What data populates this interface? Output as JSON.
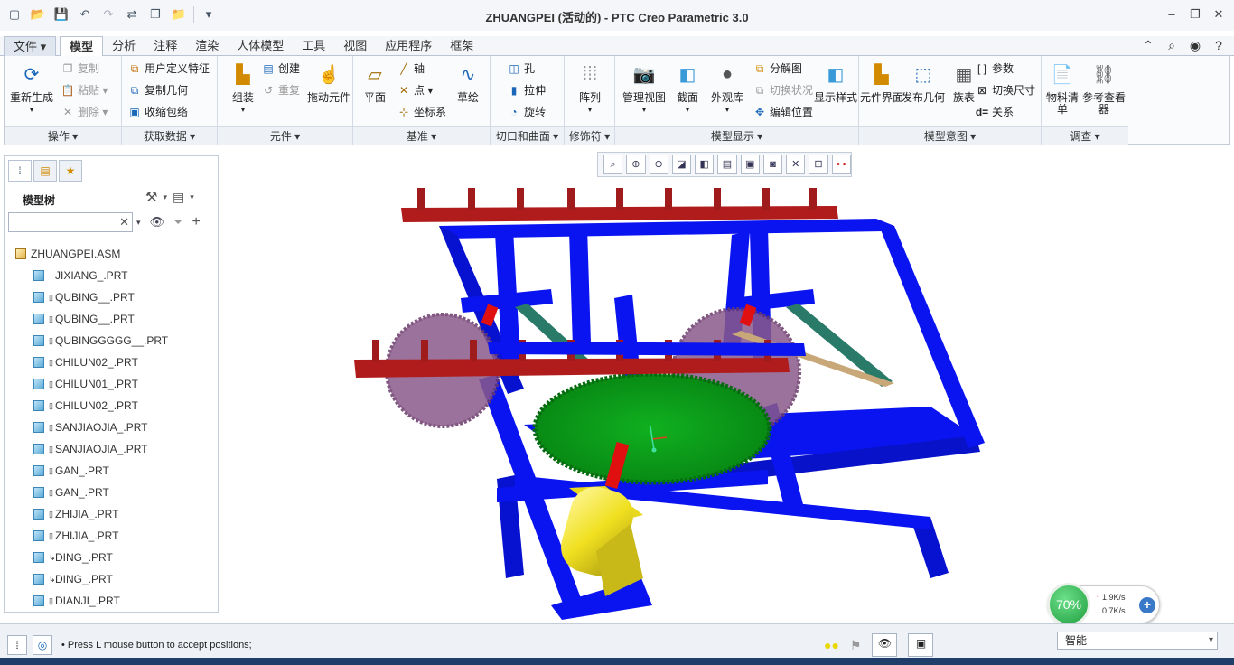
{
  "title": "ZHUANGPEI (活动的) - PTC Creo Parametric 3.0",
  "quick_access": [
    "new-icon",
    "open-icon",
    "save-icon",
    "undo-icon",
    "redo-icon",
    "regenerate-icon",
    "windows-icon",
    "close-icon",
    "customize-icon"
  ],
  "tabs": [
    {
      "label": "文件",
      "type": "file"
    },
    {
      "label": "模型",
      "type": "active"
    },
    {
      "label": "分析"
    },
    {
      "label": "注释"
    },
    {
      "label": "渲染"
    },
    {
      "label": "人体模型"
    },
    {
      "label": "工具"
    },
    {
      "label": "视图"
    },
    {
      "label": "应用程序"
    },
    {
      "label": "框架"
    }
  ],
  "ribbon": {
    "groups": {
      "operations": "操作",
      "get_data": "获取数据",
      "component": "元件",
      "datum": "基准",
      "cut_surface": "切口和曲面",
      "modifiers": "修饰符",
      "model_display": "模型显示",
      "model_intent": "模型意图",
      "investigate": "调查"
    },
    "regenerate": "重新生成",
    "copy": "复制",
    "paste": "粘贴",
    "delete": "删除",
    "user_feature": "用户定义特征",
    "copy_geometry": "复制几何",
    "shrinkwrap": "收缩包络",
    "assemble": "组装",
    "create": "创建",
    "repeat": "重复",
    "drag": "拖动元件",
    "plane": "平面",
    "axis": "轴",
    "point": "点",
    "csys": "坐标系",
    "sketch": "草绘",
    "hole": "孔",
    "extrude": "拉伸",
    "revolve": "旋转",
    "pattern": "阵列",
    "manage_views": "管理视图",
    "section": "截面",
    "appearance": "外观库",
    "explode": "分解图",
    "toggle_status": "切换状况",
    "edit_position": "编辑位置",
    "display_style": "显示样式",
    "component_interface": "元件界面",
    "publish_geometry": "发布几何",
    "family_table": "族表",
    "parameters": "参数",
    "switch_dims": "切换尺寸",
    "relations": "关系",
    "bom": "物料清单",
    "ref_viewer": "参考查看器"
  },
  "view_toolbar": [
    "refit-icon",
    "zoom-in-icon",
    "zoom-out-icon",
    "repaint-icon",
    "saved-views-icon",
    "display-style-icon",
    "perspective-icon",
    "datum-display-icon",
    "spin-center-icon",
    "annotation-display-icon",
    "interference-icon"
  ],
  "left_panel": {
    "tree_title": "模型树",
    "search_placeholder": "",
    "root": "ZHUANGPEI.ASM",
    "items": [
      {
        "name": "JIXIANG_.PRT",
        "mark": ""
      },
      {
        "name": "QUBING__.PRT",
        "mark": "▯"
      },
      {
        "name": "QUBING__.PRT",
        "mark": "▯"
      },
      {
        "name": "QUBINGGGGG__.PRT",
        "mark": "▯"
      },
      {
        "name": "CHILUN02_.PRT",
        "mark": "▯"
      },
      {
        "name": "CHILUN01_.PRT",
        "mark": "▯"
      },
      {
        "name": "CHILUN02_.PRT",
        "mark": "▯"
      },
      {
        "name": "SANJIAOJIA_.PRT",
        "mark": "▯"
      },
      {
        "name": "SANJIAOJIA_.PRT",
        "mark": "▯"
      },
      {
        "name": "GAN_.PRT",
        "mark": "▯"
      },
      {
        "name": "GAN_.PRT",
        "mark": "▯"
      },
      {
        "name": "ZHIJIA_.PRT",
        "mark": "▯"
      },
      {
        "name": "ZHIJIA_.PRT",
        "mark": "▯"
      },
      {
        "name": "DING_.PRT",
        "mark": "↳"
      },
      {
        "name": "DING_.PRT",
        "mark": "↳"
      },
      {
        "name": "DIANJI_.PRT",
        "mark": "▯"
      }
    ]
  },
  "status": {
    "message": "Press L mouse button to accept positions;",
    "filter": "智能"
  },
  "netmon": {
    "percent": "70%",
    "up": "1.9K/s",
    "down": "0.7K/s"
  },
  "colors": {
    "frame": "#0a14f0",
    "rail": "#a01c1c",
    "gear_green": "#0aa01a",
    "gear_purple": "#8a5a8a",
    "motor": "#f0e020"
  }
}
